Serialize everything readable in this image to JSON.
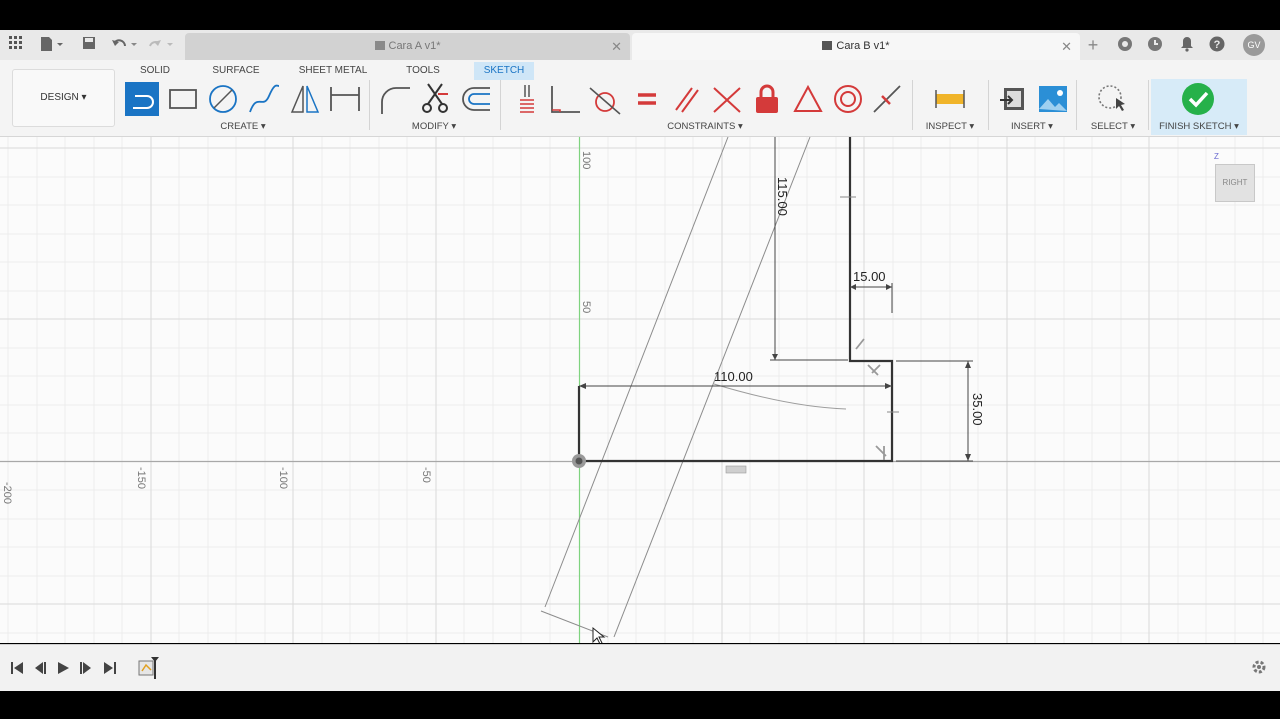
{
  "tabs": [
    {
      "label": "Cara A v1*",
      "active": false
    },
    {
      "label": "Cara B v1*",
      "active": true
    }
  ],
  "header_right": {
    "avatar": "GV"
  },
  "design_button": {
    "label": "DESIGN ▾"
  },
  "workspace_tabs": [
    "SOLID",
    "SURFACE",
    "SHEET METAL",
    "TOOLS",
    "SKETCH"
  ],
  "active_workspace": "SKETCH",
  "groups": {
    "create": "CREATE ▾",
    "modify": "MODIFY ▾",
    "constraints": "CONSTRAINTS ▾",
    "inspect": "INSPECT ▾",
    "insert": "INSERT ▾",
    "select": "SELECT ▾",
    "finish": "FINISH SKETCH ▾"
  },
  "canvas": {
    "axis_labels_x": [
      "-150",
      "-100",
      "-50"
    ],
    "axis_labels_y": [
      "100",
      "50"
    ],
    "dimensions": {
      "d115": "115.00",
      "d15": "15.00",
      "d110": "110.00",
      "d35": "35.00"
    }
  },
  "viewcube": {
    "face": "RIGHT",
    "axis": "Z"
  },
  "colors": {
    "accent": "#1a74c4",
    "finish_green": "#26b14a",
    "sketch_tab_bg": "#cfe6f7",
    "y_axis": "#7fd37f"
  }
}
